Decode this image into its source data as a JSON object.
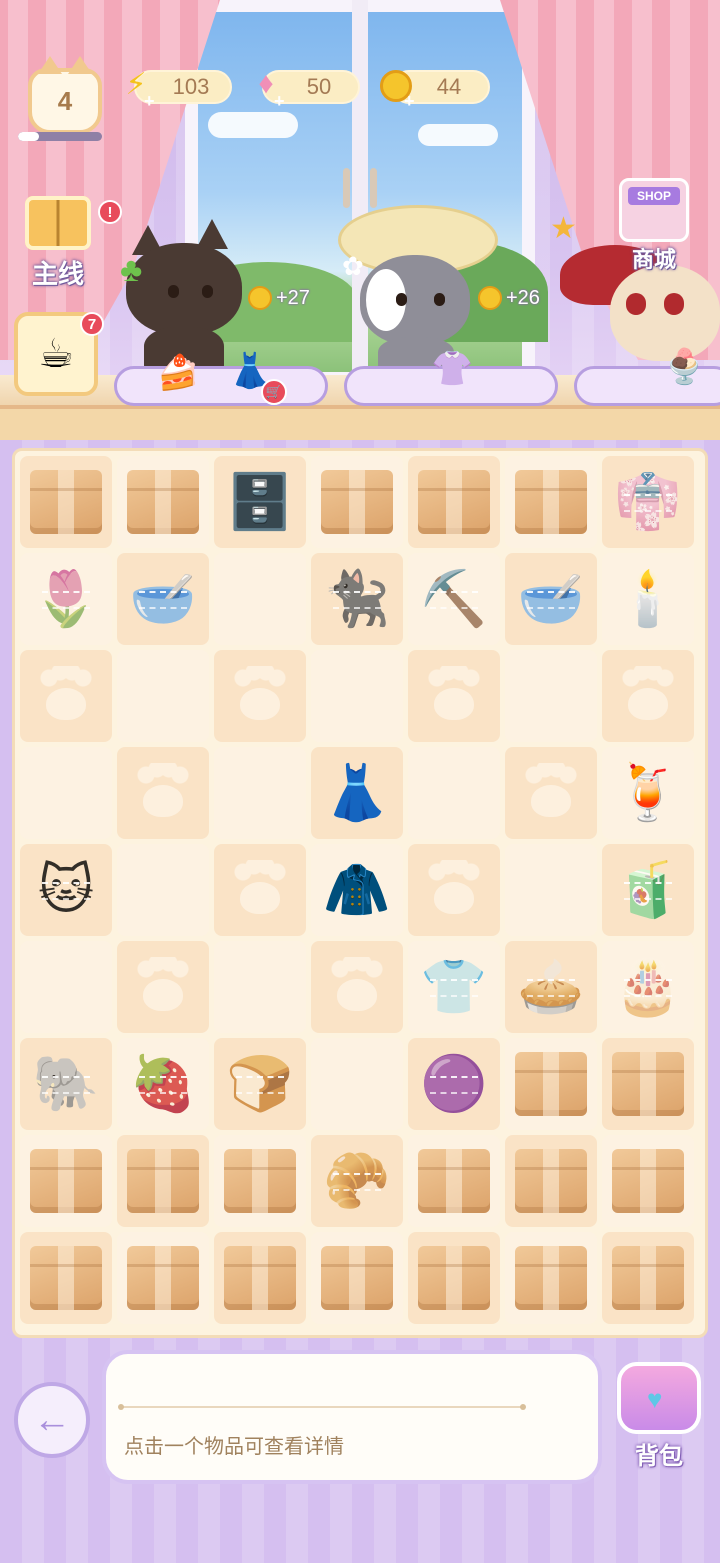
{
  "hud": {
    "level": "4",
    "xp_progress": 0.25,
    "energy": "103",
    "gems": "50",
    "coins": "44"
  },
  "side": {
    "mainline_label": "主线",
    "orders_badge": "7",
    "shop_sign": "SHOP",
    "shop_label": "商城"
  },
  "customers": [
    {
      "reward": "+27",
      "order_items": [
        "cake-slice",
        "pink-dress"
      ]
    },
    {
      "reward": "+26",
      "order_items": [
        "white-dress"
      ]
    },
    {
      "reward": "",
      "order_items": [
        "parfait"
      ]
    }
  ],
  "board": {
    "rows": [
      [
        "box",
        "box",
        "drawer-cabinet",
        "box",
        "box",
        "box",
        "clothes-rack"
      ],
      [
        "tulip",
        "pet-bowl-brown",
        "empty",
        "cat-plush",
        "shovel",
        "pet-bowl-teal",
        "candelabra"
      ],
      [
        "paw",
        "empty",
        "paw",
        "empty",
        "paw",
        "empty",
        "paw"
      ],
      [
        "empty",
        "paw",
        "empty",
        "yellow-dress",
        "empty",
        "paw",
        "juice-glass"
      ],
      [
        "cat-cushion",
        "empty",
        "paw",
        "blue-coat",
        "paw",
        "empty",
        "drink-bottle"
      ],
      [
        "empty",
        "paw",
        "empty",
        "paw",
        "clothes-rack-blue",
        "cream-tart",
        "cake-tart"
      ],
      [
        "elephant-plush",
        "fruit-tart",
        "toaster",
        "empty",
        "purple-cushion",
        "box",
        "box"
      ],
      [
        "box",
        "box",
        "box",
        "bread-loaf",
        "box",
        "box",
        "box"
      ],
      [
        "box",
        "box",
        "box",
        "box",
        "box",
        "box",
        "box"
      ]
    ]
  },
  "bottom": {
    "info_hint": "点击一个物品可查看详情",
    "backpack_label": "背包"
  }
}
